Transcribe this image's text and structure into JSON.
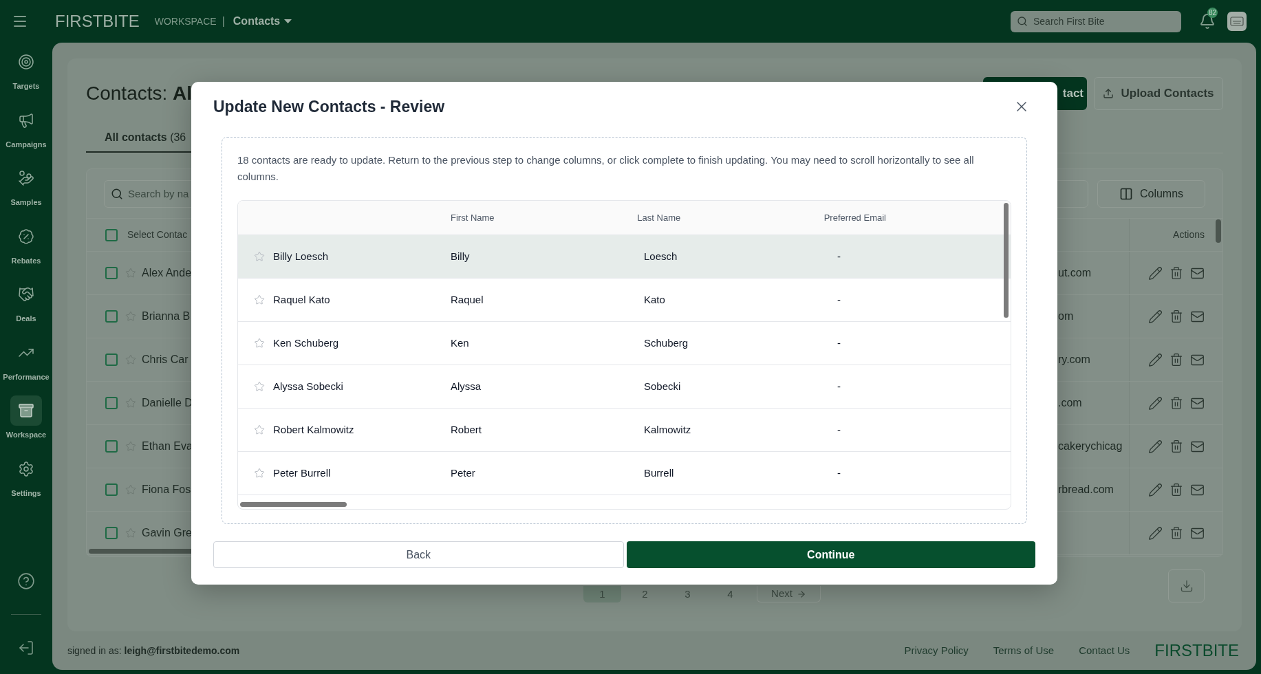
{
  "top_bar": {
    "logo": "FIRST**BITE**",
    "section": "WORKSPACE",
    "separator": "|",
    "page": "Contacts",
    "search": {
      "placeholder": "Search First Bite"
    },
    "notifications": {
      "badge": "82"
    }
  },
  "sidebar": {
    "items": [
      {
        "kind": "targets",
        "label": "Targets",
        "selected": false
      },
      {
        "kind": "campaigns",
        "label": "Campaigns",
        "selected": false
      },
      {
        "kind": "samples",
        "label": "Samples",
        "selected": false
      },
      {
        "kind": "rebates",
        "label": "Rebates",
        "selected": false
      },
      {
        "kind": "deals",
        "label": "Deals",
        "selected": false
      },
      {
        "kind": "performance",
        "label": "Performance",
        "selected": false
      },
      {
        "kind": "workspace",
        "label": "Workspace",
        "selected": true
      },
      {
        "kind": "settings",
        "label": "Settings",
        "selected": false
      }
    ]
  },
  "page": {
    "title": "Contacts: **Al**",
    "add_button": "tact",
    "upload_button": "Upload Contacts",
    "tabs": [
      {
        "label": "**All contacts** (36",
        "selected": true
      }
    ],
    "search": {
      "placeholder": "Search by na"
    },
    "columns_button": "Columns",
    "table": {
      "select_all_checked": false,
      "select_header": "Select Contac",
      "actions_header": "Actions",
      "rows": [
        {
          "name": "Alex Ande",
          "email": "ut.com",
          "checked": false,
          "starred": false
        },
        {
          "name": "Brianna B",
          "email": "om",
          "checked": false,
          "starred": false
        },
        {
          "name": "Chris Car",
          "email": "ry.com",
          "checked": false,
          "starred": false
        },
        {
          "name": "Danielle D",
          "email": ".com",
          "checked": false,
          "starred": false
        },
        {
          "name": "Ethan Eva",
          "email": "cakerychicag",
          "checked": false,
          "starred": false
        },
        {
          "name": "Fiona Fos",
          "email": "rbread.com",
          "checked": false,
          "starred": false
        },
        {
          "name": "Gavin Gre",
          "checked": false,
          "starred": false
        }
      ]
    },
    "pagination": [
      {
        "label": "1",
        "selected": true
      },
      {
        "label": "2",
        "selected": false
      },
      {
        "label": "3",
        "selected": false
      },
      {
        "label": "4",
        "selected": false
      }
    ],
    "next": "Next"
  },
  "footer": {
    "signed_in": "signed in as: **leigh@firstbitedemo.com**",
    "links": [
      "Privacy Policy",
      "Terms of Use",
      "Contact Us"
    ],
    "logo": "FIRST**BITE**"
  },
  "modal": {
    "title": "Update New Contacts - Review",
    "description": "18 contacts are ready to update. Return to the previous step to change columns, or click complete to finish updating. You may need to scroll horizontally to see all columns.",
    "columns": [
      "First Name",
      "Last Name",
      "Preferred Email"
    ],
    "rows": [
      {
        "name": "Billy Loesch",
        "first": "Billy",
        "last": "Loesch",
        "email": "-",
        "starred": false,
        "selected": true
      },
      {
        "name": "Raquel Kato",
        "first": "Raquel",
        "last": "Kato",
        "email": "-",
        "starred": false,
        "selected": false
      },
      {
        "name": "Ken Schuberg",
        "first": "Ken",
        "last": "Schuberg",
        "email": "-",
        "starred": false,
        "selected": false
      },
      {
        "name": "Alyssa Sobecki",
        "first": "Alyssa",
        "last": "Sobecki",
        "email": "-",
        "starred": false,
        "selected": false
      },
      {
        "name": "Robert Kalmowitz",
        "first": "Robert",
        "last": "Kalmowitz",
        "email": "-",
        "starred": false,
        "selected": false
      },
      {
        "name": "Peter Burrell",
        "first": "Peter",
        "last": "Burrell",
        "email": "-",
        "starred": false,
        "selected": false
      }
    ],
    "back_button": "Back",
    "continue_button": "Continue"
  }
}
